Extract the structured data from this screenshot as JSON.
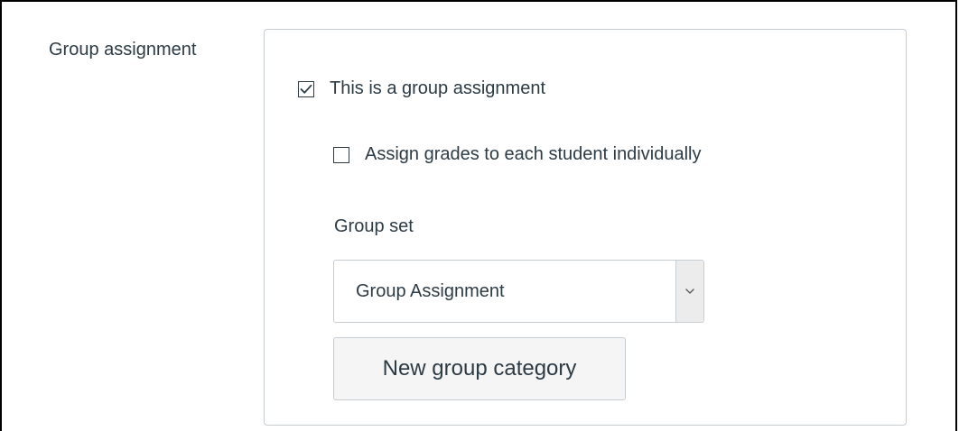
{
  "section": {
    "label": "Group assignment"
  },
  "group_assignment": {
    "checkbox_label": "This is a group assignment",
    "checked": true
  },
  "individual_grades": {
    "checkbox_label": "Assign grades to each student individually",
    "checked": false
  },
  "group_set": {
    "label": "Group set",
    "selected_value": "Group Assignment"
  },
  "new_category_button": {
    "label": "New group category"
  },
  "icons": {
    "check": "check-icon",
    "dropdown": "chevron-down-icon"
  },
  "colors": {
    "text": "#2d3b45",
    "border": "#c7cdd1",
    "button_bg": "#f5f5f5"
  }
}
